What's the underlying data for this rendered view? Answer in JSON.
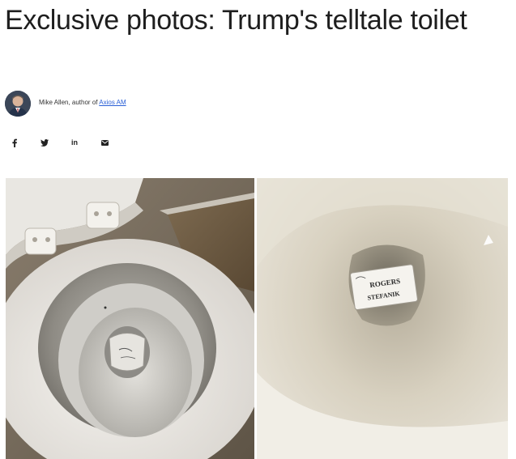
{
  "article": {
    "headline": "Exclusive photos: Trump's telltale toilet"
  },
  "byline": {
    "author_prefix": "Mike Allen, author of ",
    "author_link": "Axios AM"
  },
  "share": {
    "facebook": "f",
    "twitter": "y",
    "linkedin": "in",
    "email": "✉"
  },
  "photo_right": {
    "note_line_1": "ROGERS",
    "note_line_2": "STEFANIK"
  },
  "icons": [
    "facebook-icon",
    "twitter-icon",
    "linkedin-icon",
    "email-icon"
  ],
  "colors": {
    "link": "#2a5fd6",
    "headline": "#1e1e1e"
  }
}
